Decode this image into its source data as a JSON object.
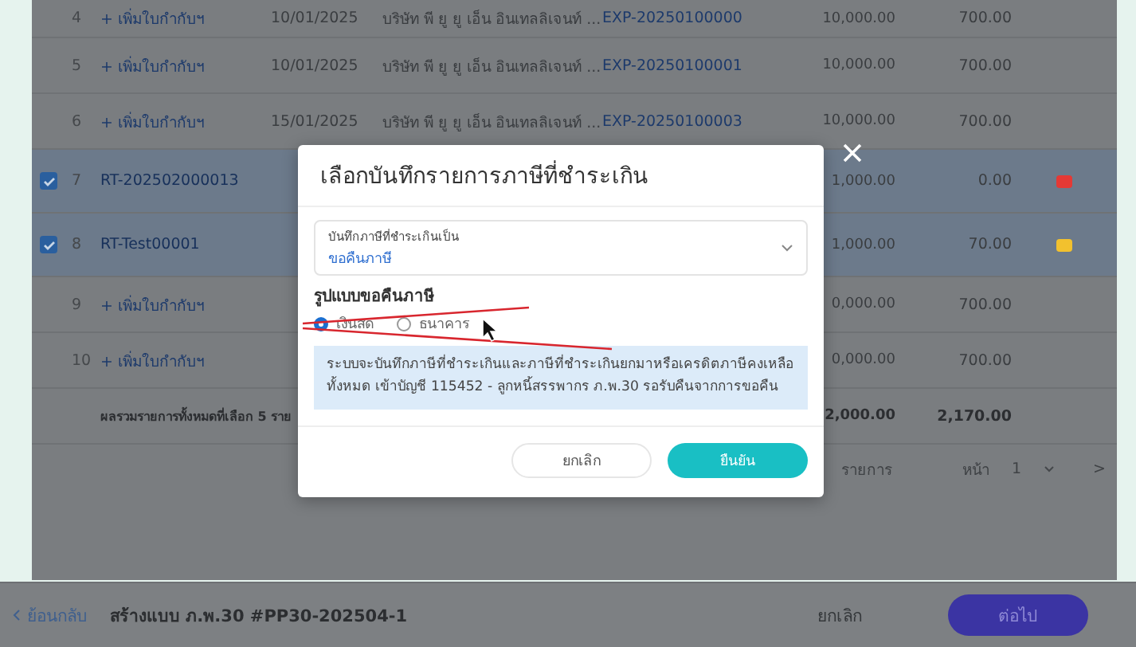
{
  "table": {
    "rows": [
      {
        "number": "4",
        "checked": false,
        "reference": "+ เพิ่มใบกำกับฯ",
        "date": "10/01/2025",
        "company": "บริษัท พี ยู ยู เอ็น อินเทลลิเจนท์ ...",
        "document": "EXP-20250100000",
        "amount": "10,000.00",
        "tax": "700.00"
      },
      {
        "number": "5",
        "checked": false,
        "reference": "+ เพิ่มใบกำกับฯ",
        "date": "10/01/2025",
        "company": "บริษัท พี ยู ยู เอ็น อินเทลลิเจนท์ ...",
        "document": "EXP-20250100001",
        "amount": "10,000.00",
        "tax": "700.00"
      },
      {
        "number": "6",
        "checked": false,
        "reference": "+ เพิ่มใบกำกับฯ",
        "date": "15/01/2025",
        "company": "บริษัท พี ยู ยู เอ็น อินเทลลิเจนท์ ...",
        "document": "EXP-20250100003",
        "amount": "10,000.00",
        "tax": "700.00"
      },
      {
        "number": "7",
        "checked": true,
        "reference": "RT-202502000013",
        "amount": "1,000.00",
        "tax": "0.00",
        "color": "#e53935"
      },
      {
        "number": "8",
        "checked": true,
        "reference": "RT-Test00001",
        "amount": "1,000.00",
        "tax": "70.00",
        "color": "#f2c12e"
      },
      {
        "number": "9",
        "checked": false,
        "reference": "+ เพิ่มใบกำกับฯ",
        "amount": "0,000.00",
        "tax": "700.00"
      },
      {
        "number": "10",
        "checked": false,
        "reference": "+ เพิ่มใบกำกับฯ",
        "amount": "0,000.00",
        "tax": "700.00"
      }
    ],
    "total": {
      "label": "ผลรวมรายการทั้งหมดที่เลือก 5 ราย",
      "amount": "2,000.00",
      "tax": "2,170.00"
    },
    "pagination": {
      "rows_label": "รายการ",
      "page_label": "หน้า",
      "page": "1",
      "next": ">"
    }
  },
  "bottom_bar": {
    "back": "ย้อนกลับ",
    "title": "สร้างแบบ ภ.พ.30 #PP30-202504-1",
    "cancel": "ยกเลิก",
    "next": "ต่อไป"
  },
  "dialog": {
    "title": "เลือกบันทึกรายการภาษีที่ชำระเกิน",
    "select": {
      "label": "บันทึกภาษีที่ชำระเกินเป็น",
      "value": "ขอคืนภาษี"
    },
    "section_title": "รูปแบบขอคืนภาษี",
    "options": [
      {
        "label": "เงินสด",
        "selected": true
      },
      {
        "label": "ธนาคาร",
        "selected": false
      }
    ],
    "info": "ระบบจะบันทึกภาษีที่ชำระเกินและภาษีที่ชำระเกินยกมาหรือเครดิตภาษีคงเหลือทั้งหมด เข้าบัญชี 115452 - ลูกหนี้สรรพากร ภ.พ.30 รอรับคืนจากการขอคืน",
    "cancel": "ยกเลิก",
    "confirm": "ยืนยัน"
  }
}
